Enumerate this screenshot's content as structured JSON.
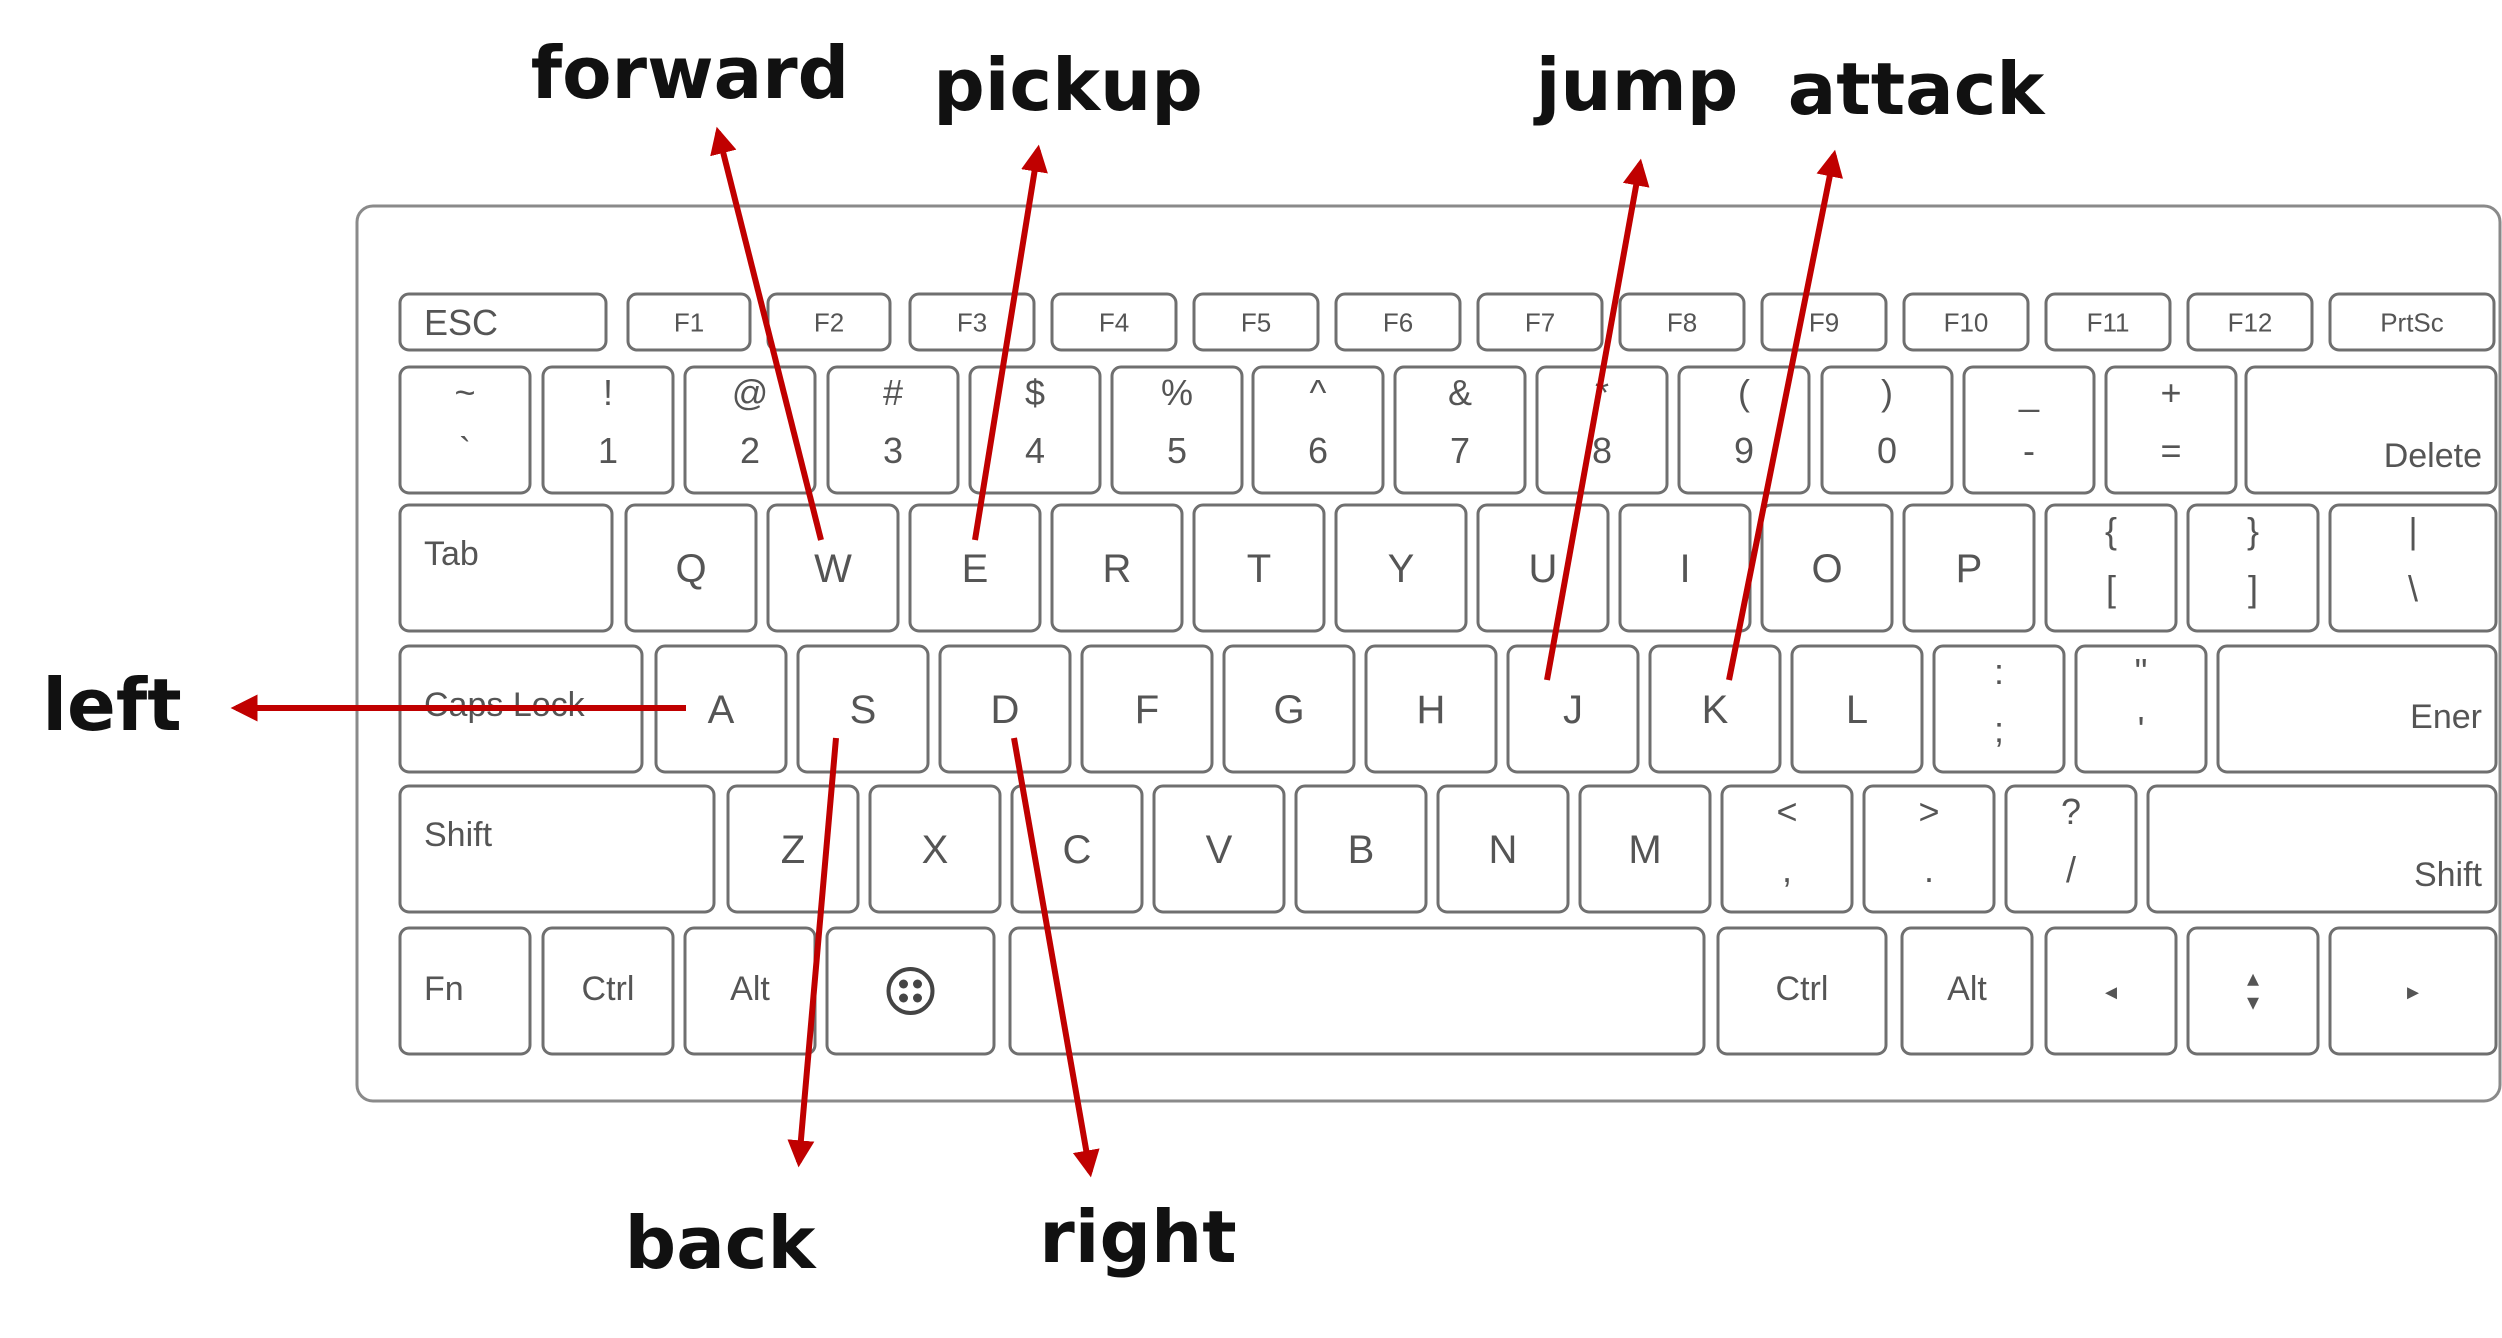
{
  "keyboard": {
    "rows": [
      [
        {
          "id": "esc",
          "legends": [
            "ESC"
          ]
        },
        {
          "id": "f1",
          "legends": [
            "F1"
          ]
        },
        {
          "id": "f2",
          "legends": [
            "F2"
          ]
        },
        {
          "id": "f3",
          "legends": [
            "F3"
          ]
        },
        {
          "id": "f4",
          "legends": [
            "F4"
          ]
        },
        {
          "id": "f5",
          "legends": [
            "F5"
          ]
        },
        {
          "id": "f6",
          "legends": [
            "F6"
          ]
        },
        {
          "id": "f7",
          "legends": [
            "F7"
          ]
        },
        {
          "id": "f8",
          "legends": [
            "F8"
          ]
        },
        {
          "id": "f9",
          "legends": [
            "F9"
          ]
        },
        {
          "id": "f10",
          "legends": [
            "F10"
          ]
        },
        {
          "id": "f11",
          "legends": [
            "F11"
          ]
        },
        {
          "id": "f12",
          "legends": [
            "F12"
          ]
        },
        {
          "id": "prtsc",
          "legends": [
            "PrtSc"
          ]
        }
      ],
      [
        {
          "id": "backtick",
          "legends": [
            "~",
            "`"
          ]
        },
        {
          "id": "1",
          "legends": [
            "!",
            "1"
          ]
        },
        {
          "id": "2",
          "legends": [
            "@",
            "2"
          ]
        },
        {
          "id": "3",
          "legends": [
            "#",
            "3"
          ]
        },
        {
          "id": "4",
          "legends": [
            "$",
            "4"
          ]
        },
        {
          "id": "5",
          "legends": [
            "%",
            "5"
          ]
        },
        {
          "id": "6",
          "legends": [
            "^",
            "6"
          ]
        },
        {
          "id": "7",
          "legends": [
            "&",
            "7"
          ]
        },
        {
          "id": "8",
          "legends": [
            "*",
            "8"
          ]
        },
        {
          "id": "9",
          "legends": [
            "(",
            "9"
          ]
        },
        {
          "id": "0",
          "legends": [
            ")",
            "0"
          ]
        },
        {
          "id": "minus",
          "legends": [
            "_",
            "-"
          ]
        },
        {
          "id": "equals",
          "legends": [
            "+",
            "="
          ]
        },
        {
          "id": "delete",
          "legends": [
            "Delete"
          ]
        }
      ],
      [
        {
          "id": "tab",
          "legends": [
            "Tab"
          ]
        },
        {
          "id": "q",
          "legends": [
            "Q"
          ]
        },
        {
          "id": "w",
          "legends": [
            "W"
          ]
        },
        {
          "id": "e",
          "legends": [
            "E"
          ]
        },
        {
          "id": "r",
          "legends": [
            "R"
          ]
        },
        {
          "id": "t",
          "legends": [
            "T"
          ]
        },
        {
          "id": "y",
          "legends": [
            "Y"
          ]
        },
        {
          "id": "u",
          "legends": [
            "U"
          ]
        },
        {
          "id": "i",
          "legends": [
            "I"
          ]
        },
        {
          "id": "o",
          "legends": [
            "O"
          ]
        },
        {
          "id": "p",
          "legends": [
            "P"
          ]
        },
        {
          "id": "lbracket",
          "legends": [
            "{",
            "["
          ]
        },
        {
          "id": "rbracket",
          "legends": [
            "}",
            "]"
          ]
        },
        {
          "id": "backslash",
          "legends": [
            "|",
            "\\"
          ]
        }
      ],
      [
        {
          "id": "capslock",
          "legends": [
            "Caps Lock"
          ]
        },
        {
          "id": "a",
          "legends": [
            "A"
          ]
        },
        {
          "id": "s",
          "legends": [
            "S"
          ]
        },
        {
          "id": "d",
          "legends": [
            "D"
          ]
        },
        {
          "id": "f",
          "legends": [
            "F"
          ]
        },
        {
          "id": "g",
          "legends": [
            "G"
          ]
        },
        {
          "id": "h",
          "legends": [
            "H"
          ]
        },
        {
          "id": "j",
          "legends": [
            "J"
          ]
        },
        {
          "id": "k",
          "legends": [
            "K"
          ]
        },
        {
          "id": "l",
          "legends": [
            "L"
          ]
        },
        {
          "id": "semicolon",
          "legends": [
            ":",
            ";"
          ]
        },
        {
          "id": "quote",
          "legends": [
            "\"",
            "'"
          ]
        },
        {
          "id": "enter",
          "legends": [
            "Ener"
          ]
        }
      ],
      [
        {
          "id": "lshift",
          "legends": [
            "Shift"
          ]
        },
        {
          "id": "z",
          "legends": [
            "Z"
          ]
        },
        {
          "id": "x",
          "legends": [
            "X"
          ]
        },
        {
          "id": "c",
          "legends": [
            "C"
          ]
        },
        {
          "id": "v",
          "legends": [
            "V"
          ]
        },
        {
          "id": "b",
          "legends": [
            "B"
          ]
        },
        {
          "id": "n",
          "legends": [
            "N"
          ]
        },
        {
          "id": "m",
          "legends": [
            "M"
          ]
        },
        {
          "id": "comma",
          "legends": [
            "<",
            ","
          ]
        },
        {
          "id": "period",
          "legends": [
            ">",
            "."
          ]
        },
        {
          "id": "slash",
          "legends": [
            "?",
            "/"
          ]
        },
        {
          "id": "rshift",
          "legends": [
            "Shift"
          ]
        }
      ],
      [
        {
          "id": "fn",
          "legends": [
            "Fn"
          ]
        },
        {
          "id": "lctrl",
          "legends": [
            "Ctrl"
          ]
        },
        {
          "id": "lalt",
          "legends": [
            "Alt"
          ]
        },
        {
          "id": "win",
          "legends": [],
          "icon": "windows-logo-icon"
        },
        {
          "id": "space",
          "legends": []
        },
        {
          "id": "rctrl",
          "legends": [
            "Ctrl"
          ]
        },
        {
          "id": "ralt",
          "legends": [
            "Alt"
          ]
        },
        {
          "id": "left",
          "legends": [
            "◂"
          ]
        },
        {
          "id": "updown",
          "legends": [
            "▴",
            "▾"
          ]
        },
        {
          "id": "right",
          "legends": [
            "▸"
          ]
        }
      ]
    ]
  },
  "annotations": [
    {
      "id": "forward",
      "text": "forward",
      "key": "w"
    },
    {
      "id": "pickup",
      "text": "pickup",
      "key": "e"
    },
    {
      "id": "jump",
      "text": "jump",
      "key": "j"
    },
    {
      "id": "attack",
      "text": "attack",
      "key": "k"
    },
    {
      "id": "left",
      "text": "left",
      "key": "a"
    },
    {
      "id": "back",
      "text": "back",
      "key": "s"
    },
    {
      "id": "right",
      "text": "right",
      "key": "d"
    }
  ],
  "colors": {
    "arrow": "#c00000",
    "key_border": "#6f6f6f",
    "keyboard_border": "#8a8a8a",
    "key_text": "#555555",
    "label_text": "#111111"
  }
}
